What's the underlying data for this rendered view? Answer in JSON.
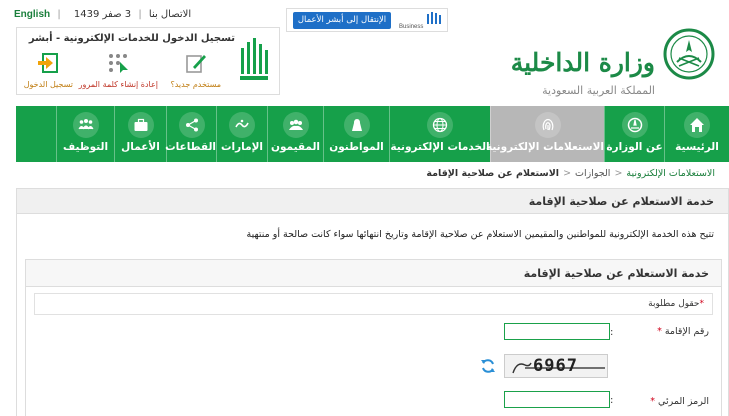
{
  "header": {
    "lang_link": "English",
    "contact_link": "الاتصال بنا",
    "date": "3 صفر 1439",
    "absher": {
      "title": "تسجيل الدخول للخدمات الإلكترونية - أبشر",
      "items": [
        {
          "label": "مستخدم جديد؟",
          "icon": "new-user-icon"
        },
        {
          "label": "إعادة إنشاء كلمة المرور",
          "icon": "password-reset-icon"
        },
        {
          "label": "تسجيل الدخول",
          "icon": "login-icon"
        }
      ]
    },
    "business_button": "الإنتقال إلى أبشر الأعمال",
    "business_logo_text": "أبشر Business",
    "ministry_name": "وزارة الداخلية",
    "kingdom_name": "المملكة العربية السعودية"
  },
  "nav": {
    "items": [
      {
        "label": "الرئيسية",
        "icon": "home-icon"
      },
      {
        "label": "عن الوزارة",
        "icon": "emblem-icon"
      },
      {
        "label": "الاستعلامات الإلكترونية",
        "icon": "fingerprint-icon"
      },
      {
        "label": "الخدمات الإلكترونية",
        "icon": "globe-icon"
      },
      {
        "label": "المواطنون",
        "icon": "citizen-icon"
      },
      {
        "label": "المقيمون",
        "icon": "residents-icon"
      },
      {
        "label": "الإمارات",
        "icon": "emirates-icon"
      },
      {
        "label": "القطاعات",
        "icon": "sectors-icon"
      },
      {
        "label": "الأعمال",
        "icon": "briefcase-icon"
      },
      {
        "label": "التوظيف",
        "icon": "employment-icon"
      }
    ],
    "active_index": 2
  },
  "breadcrumb": {
    "items": [
      "الاستعلامات الإلكترونية",
      "الجوازات",
      "الاستعلام عن صلاحية الإقامة"
    ]
  },
  "service": {
    "title": "خدمة الاستعلام عن صلاحية الإقامة",
    "description": "تتيح هذه الخدمة الإلكترونية للمواطنين والمقيمين الاستعلام عن صلاحية الإقامة وتاريخ انتهائها سواء كانت صالحة أو منتهية",
    "form_title": "خدمة الاستعلام عن صلاحية الإقامة",
    "required_note": "حقول مطلوبة",
    "iqama_label": "رقم الإقامة",
    "iqama_value": "",
    "captcha_text": "6967",
    "code_label": "الرمز المرئي",
    "code_value": ""
  },
  "colors": {
    "brand_green": "#16a04a",
    "active_nav": "#b7b7b7",
    "link_blue": "#1e6fc7"
  }
}
